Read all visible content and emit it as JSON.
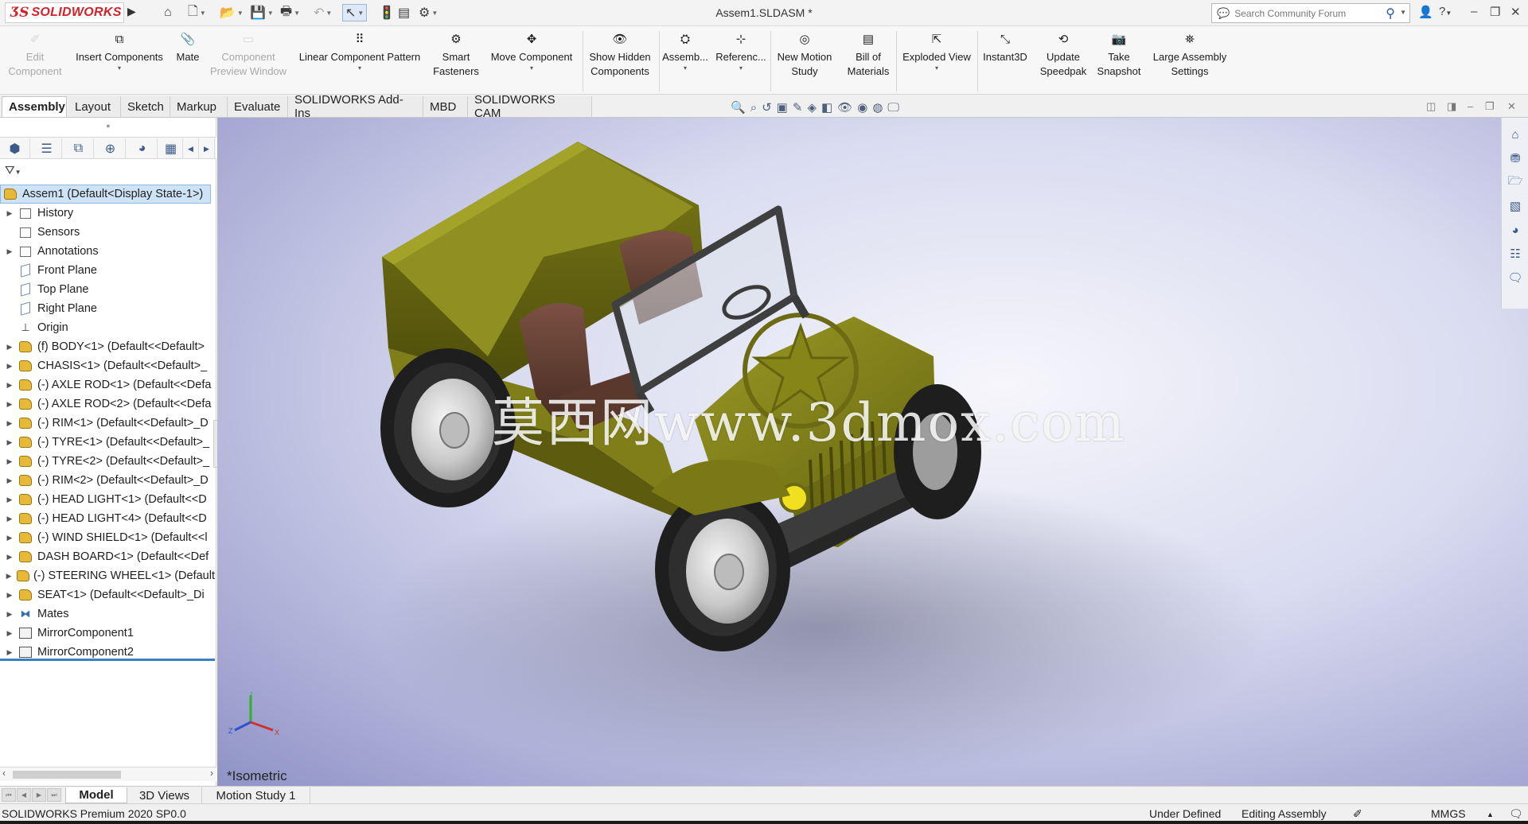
{
  "app": {
    "logo_text": "SOLIDWORKS",
    "document_title": "Assem1.SLDASM *",
    "search_placeholder": "Search Community Forum"
  },
  "ribbon": {
    "buttons": [
      {
        "label": "Edit Component",
        "icon": "edit-component-icon",
        "enabled": false
      },
      {
        "label": "Insert Components",
        "icon": "insert-components-icon",
        "enabled": true,
        "dropdown": true
      },
      {
        "label": "Mate",
        "icon": "mate-icon",
        "enabled": true
      },
      {
        "label": "Component Preview Window",
        "icon": "preview-window-icon",
        "enabled": false
      },
      {
        "label": "Linear Component Pattern",
        "icon": "linear-pattern-icon",
        "enabled": true,
        "dropdown": true
      },
      {
        "label": "Smart Fasteners",
        "icon": "smart-fasteners-icon",
        "enabled": true
      },
      {
        "label": "Move Component",
        "icon": "move-component-icon",
        "enabled": true,
        "dropdown": true
      },
      {
        "label": "Show Hidden Components",
        "icon": "show-hidden-icon",
        "enabled": true
      },
      {
        "label": "Assemb...",
        "icon": "assembly-features-icon",
        "enabled": true,
        "dropdown": true
      },
      {
        "label": "Referenc...",
        "icon": "reference-geometry-icon",
        "enabled": true,
        "dropdown": true
      },
      {
        "label": "New Motion Study",
        "icon": "motion-study-icon",
        "enabled": true
      },
      {
        "label": "Bill of Materials",
        "icon": "bom-icon",
        "enabled": true
      },
      {
        "label": "Exploded View",
        "icon": "exploded-view-icon",
        "enabled": true,
        "dropdown": true
      },
      {
        "label": "Instant3D",
        "icon": "instant3d-icon",
        "enabled": true
      },
      {
        "label": "Update Speedpak",
        "icon": "speedpak-icon",
        "enabled": true
      },
      {
        "label": "Take Snapshot",
        "icon": "snapshot-icon",
        "enabled": true
      },
      {
        "label": "Large Assembly Settings",
        "icon": "large-assembly-icon",
        "enabled": true
      }
    ]
  },
  "tabs": {
    "items": [
      "Assembly",
      "Layout",
      "Sketch",
      "Markup",
      "Evaluate",
      "SOLIDWORKS Add-Ins",
      "MBD",
      "SOLIDWORKS CAM"
    ],
    "active": "Assembly"
  },
  "tree": {
    "root": "Assem1  (Default<Display State-1>)",
    "nodes": [
      {
        "label": "History",
        "icon": "history-icon",
        "expandable": true
      },
      {
        "label": "Sensors",
        "icon": "sensors-icon",
        "expandable": false
      },
      {
        "label": "Annotations",
        "icon": "annotations-icon",
        "expandable": true
      },
      {
        "label": "Front Plane",
        "icon": "plane-icon",
        "expandable": false
      },
      {
        "label": "Top Plane",
        "icon": "plane-icon",
        "expandable": false
      },
      {
        "label": "Right Plane",
        "icon": "plane-icon",
        "expandable": false
      },
      {
        "label": "Origin",
        "icon": "origin-icon",
        "expandable": false
      },
      {
        "label": "(f) BODY<1> (Default<<Default>",
        "icon": "component-icon",
        "expandable": true
      },
      {
        "label": "CHASIS<1> (Default<<Default>_",
        "icon": "component-icon",
        "expandable": true
      },
      {
        "label": "(-) AXLE ROD<1> (Default<<Defa",
        "icon": "component-icon",
        "expandable": true
      },
      {
        "label": "(-) AXLE ROD<2> (Default<<Defa",
        "icon": "component-icon",
        "expandable": true
      },
      {
        "label": "(-) RIM<1> (Default<<Default>_D",
        "icon": "component-icon",
        "expandable": true
      },
      {
        "label": "(-) TYRE<1> (Default<<Default>_",
        "icon": "component-icon",
        "expandable": true
      },
      {
        "label": "(-) TYRE<2> (Default<<Default>_",
        "icon": "component-icon",
        "expandable": true
      },
      {
        "label": "(-) RIM<2> (Default<<Default>_D",
        "icon": "component-icon",
        "expandable": true
      },
      {
        "label": "(-) HEAD LIGHT<1> (Default<<D",
        "icon": "component-icon",
        "expandable": true
      },
      {
        "label": "(-) HEAD LIGHT<4> (Default<<D",
        "icon": "component-icon",
        "expandable": true
      },
      {
        "label": "(-) WIND SHIELD<1> (Default<<l",
        "icon": "component-icon",
        "expandable": true
      },
      {
        "label": "DASH BOARD<1> (Default<<Def",
        "icon": "component-icon",
        "expandable": true
      },
      {
        "label": "(-) STEERING WHEEL<1> (Default",
        "icon": "component-icon",
        "expandable": true
      },
      {
        "label": "SEAT<1> (Default<<Default>_Di",
        "icon": "component-icon",
        "expandable": true
      },
      {
        "label": "Mates",
        "icon": "mates-icon",
        "expandable": true
      },
      {
        "label": "MirrorComponent1",
        "icon": "mirror-component-icon",
        "expandable": true
      },
      {
        "label": "MirrorComponent2",
        "icon": "mirror-component-icon",
        "expandable": true
      }
    ]
  },
  "viewport": {
    "watermark": "莫西网www.3dmox.com",
    "view_label": "*Isometric",
    "triad_labels": {
      "y": "Y",
      "z": "Z",
      "x": "X"
    }
  },
  "bottom_tabs": {
    "items": [
      "Model",
      "3D Views",
      "Motion Study 1"
    ],
    "active": "Model"
  },
  "status": {
    "product": "SOLIDWORKS Premium 2020 SP0.0",
    "definition": "Under Defined",
    "mode": "Editing Assembly",
    "units": "MMGS"
  },
  "colors": {
    "body": "#7b7a1a",
    "seat": "#6b4536",
    "accent": "#d2232a",
    "selection": "#cfe3f7"
  }
}
